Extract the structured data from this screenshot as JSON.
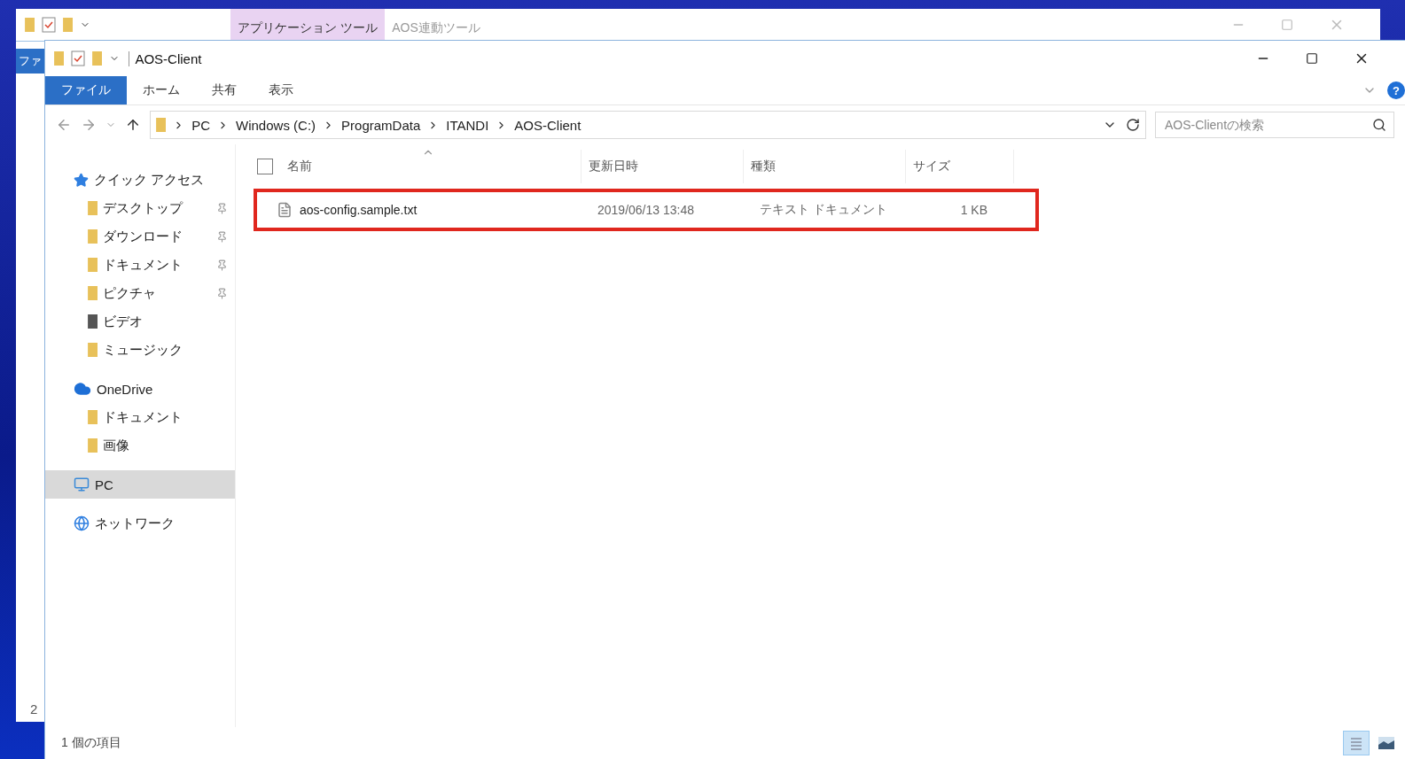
{
  "back_window": {
    "title_tabs": [
      {
        "label": "アプリケーション ツール",
        "selected": true
      },
      {
        "label": "AOS連動ツール",
        "selected": false
      }
    ],
    "ribbon_tab": "ファ",
    "side_number": "2"
  },
  "window": {
    "title": "AOS-Client",
    "ribbon_tabs": [
      {
        "label": "ファイル",
        "selected": true
      },
      {
        "label": "ホーム",
        "selected": false
      },
      {
        "label": "共有",
        "selected": false
      },
      {
        "label": "表示",
        "selected": false
      }
    ],
    "help": "?",
    "breadcrumb": [
      "PC",
      "Windows (C:)",
      "ProgramData",
      "ITANDI",
      "AOS-Client"
    ],
    "search": {
      "placeholder": "AOS-Clientの検索"
    },
    "nav": [
      {
        "label": "クイック アクセス",
        "kind": "star",
        "selected": false,
        "children": [
          {
            "label": "デスクトップ",
            "kind": "desktop",
            "pinned": true,
            "selected": false
          },
          {
            "label": "ダウンロード",
            "kind": "download",
            "pinned": true,
            "selected": false
          },
          {
            "label": "ドキュメント",
            "kind": "document",
            "pinned": true,
            "selected": false
          },
          {
            "label": "ピクチャ",
            "kind": "picture",
            "pinned": true,
            "selected": false
          },
          {
            "label": "ビデオ",
            "kind": "video",
            "pinned": false,
            "selected": false
          },
          {
            "label": "ミュージック",
            "kind": "music",
            "pinned": false,
            "selected": false
          }
        ]
      },
      {
        "label": "OneDrive",
        "kind": "cloud",
        "selected": false,
        "children": [
          {
            "label": "ドキュメント",
            "kind": "folder",
            "pinned": false,
            "selected": false
          },
          {
            "label": "画像",
            "kind": "folder",
            "pinned": false,
            "selected": false
          }
        ]
      },
      {
        "label": "PC",
        "kind": "pc",
        "selected": true
      },
      {
        "label": "ネットワーク",
        "kind": "network",
        "selected": false
      }
    ],
    "select_all": {
      "checked": false
    },
    "columns": [
      "名前",
      "更新日時",
      "種類",
      "サイズ"
    ],
    "rows": [
      {
        "name": "aos-config.sample.txt",
        "date": "2019/06/13 13:48",
        "type": "テキスト ドキュメント",
        "size": "1 KB",
        "highlighted": true
      }
    ],
    "status": "1 個の項目",
    "views": [
      {
        "kind": "details",
        "selected": true
      },
      {
        "kind": "large",
        "selected": false
      }
    ]
  }
}
